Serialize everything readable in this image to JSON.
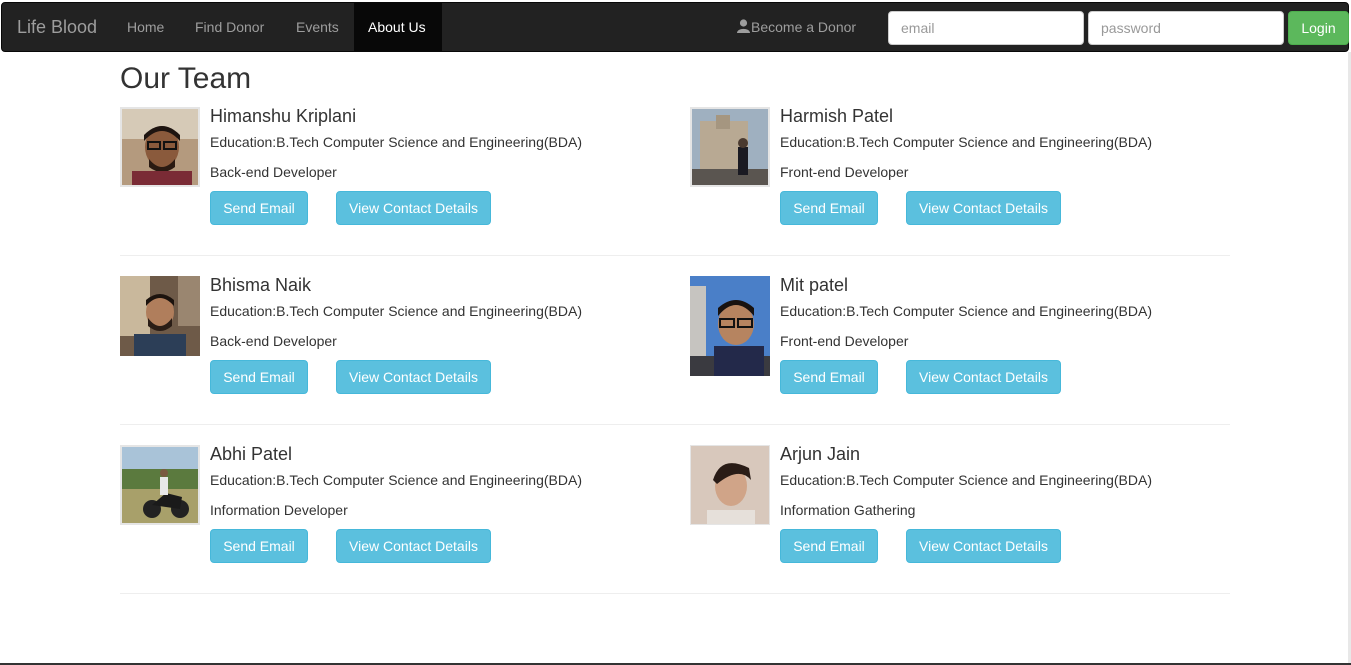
{
  "nav": {
    "brand": "Life Blood",
    "links": [
      {
        "label": "Home"
      },
      {
        "label": "Find Donor"
      },
      {
        "label": "Events"
      },
      {
        "label": "About Us",
        "active": true
      }
    ],
    "become_donor": "Become a Donor",
    "email_placeholder": "email",
    "password_placeholder": "password",
    "login_label": "Login"
  },
  "page": {
    "title": "Our Team"
  },
  "buttons": {
    "send_email": "Send Email",
    "view_contact": "View Contact Details"
  },
  "members": [
    {
      "name": "Himanshu Kriplani",
      "education": "Education:B.Tech Computer Science and Engineering(BDA)",
      "role": "Back-end Developer"
    },
    {
      "name": "Harmish Patel",
      "education": "Education:B.Tech Computer Science and Engineering(BDA)",
      "role": "Front-end Developer"
    },
    {
      "name": "Bhisma Naik",
      "education": "Education:B.Tech Computer Science and Engineering(BDA)",
      "role": "Back-end Developer"
    },
    {
      "name": "Mit patel",
      "education": "Education:B.Tech Computer Science and Engineering(BDA)",
      "role": "Front-end Developer"
    },
    {
      "name": "Abhi Patel",
      "education": "Education:B.Tech Computer Science and Engineering(BDA)",
      "role": "Information Developer"
    },
    {
      "name": "Arjun Jain",
      "education": "Education:B.Tech Computer Science and Engineering(BDA)",
      "role": "Information Gathering"
    }
  ],
  "colors": {
    "navbar": "#222222",
    "login_button": "#5cb85c",
    "info_button": "#5bc0de"
  }
}
